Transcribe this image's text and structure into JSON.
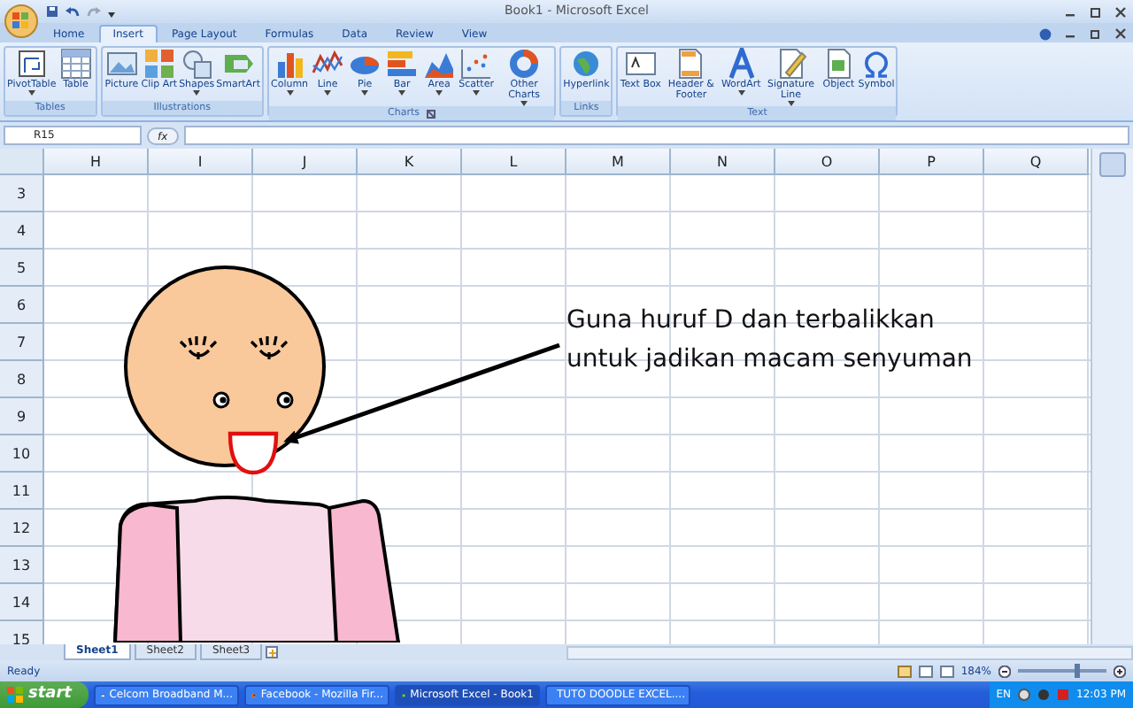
{
  "window": {
    "title": "Book1 - Microsoft Excel"
  },
  "ribbon": {
    "tabs": [
      {
        "label": "Home",
        "selected": false
      },
      {
        "label": "Insert",
        "selected": true
      },
      {
        "label": "Page Layout",
        "selected": false
      },
      {
        "label": "Formulas",
        "selected": false
      },
      {
        "label": "Data",
        "selected": false
      },
      {
        "label": "Review",
        "selected": false
      },
      {
        "label": "View",
        "selected": false
      }
    ],
    "groups": [
      {
        "label": "Tables",
        "launcher": false,
        "buttons": [
          {
            "label": "PivotTable",
            "dropdown": true
          },
          {
            "label": "Table",
            "dropdown": false
          }
        ]
      },
      {
        "label": "Illustrations",
        "launcher": false,
        "buttons": [
          {
            "label": "Picture",
            "dropdown": false
          },
          {
            "label": "Clip Art",
            "dropdown": false
          },
          {
            "label": "Shapes",
            "dropdown": true
          },
          {
            "label": "SmartArt",
            "dropdown": false
          }
        ]
      },
      {
        "label": "Charts",
        "launcher": true,
        "buttons": [
          {
            "label": "Column",
            "dropdown": true
          },
          {
            "label": "Line",
            "dropdown": true
          },
          {
            "label": "Pie",
            "dropdown": true
          },
          {
            "label": "Bar",
            "dropdown": true
          },
          {
            "label": "Area",
            "dropdown": true
          },
          {
            "label": "Scatter",
            "dropdown": true
          },
          {
            "label": "Other Charts",
            "dropdown": true
          }
        ]
      },
      {
        "label": "Links",
        "launcher": false,
        "buttons": [
          {
            "label": "Hyperlink",
            "dropdown": false
          }
        ]
      },
      {
        "label": "Text",
        "launcher": false,
        "buttons": [
          {
            "label": "Text Box",
            "dropdown": false
          },
          {
            "label": "Header & Footer",
            "dropdown": false
          },
          {
            "label": "WordArt",
            "dropdown": true
          },
          {
            "label": "Signature Line",
            "dropdown": true
          },
          {
            "label": "Object",
            "dropdown": false
          },
          {
            "label": "Symbol",
            "dropdown": false
          }
        ]
      }
    ]
  },
  "formula_bar": {
    "name_box": "R15",
    "fx": "fx"
  },
  "sheet": {
    "columns": [
      "H",
      "I",
      "J",
      "K",
      "L",
      "M",
      "N",
      "O",
      "P",
      "Q"
    ],
    "rows": [
      "3",
      "4",
      "5",
      "6",
      "7",
      "8",
      "9",
      "10",
      "11",
      "12",
      "13",
      "14",
      "15"
    ],
    "callout": {
      "lines": [
        "Guna huruf D dan terbalikkan",
        "untuk jadikan macam senyuman"
      ]
    }
  },
  "sheet_tabs": [
    {
      "label": "Sheet1",
      "selected": true
    },
    {
      "label": "Sheet2",
      "selected": false
    },
    {
      "label": "Sheet3",
      "selected": false
    }
  ],
  "status_bar": {
    "text": "Ready",
    "zoom": "184%",
    "zoom_slider": {
      "level": 0.65
    }
  },
  "taskbar": {
    "start": "start",
    "tasks": [
      {
        "label": "Celcom Broadband M...",
        "selected": false
      },
      {
        "label": "Facebook - Mozilla Fir...",
        "selected": false
      },
      {
        "label": "Microsoft Excel - Book1",
        "selected": true
      },
      {
        "label": "TUTO DOODLE EXCEL....",
        "selected": false
      }
    ],
    "language": "EN",
    "clock": "12:03 PM"
  }
}
